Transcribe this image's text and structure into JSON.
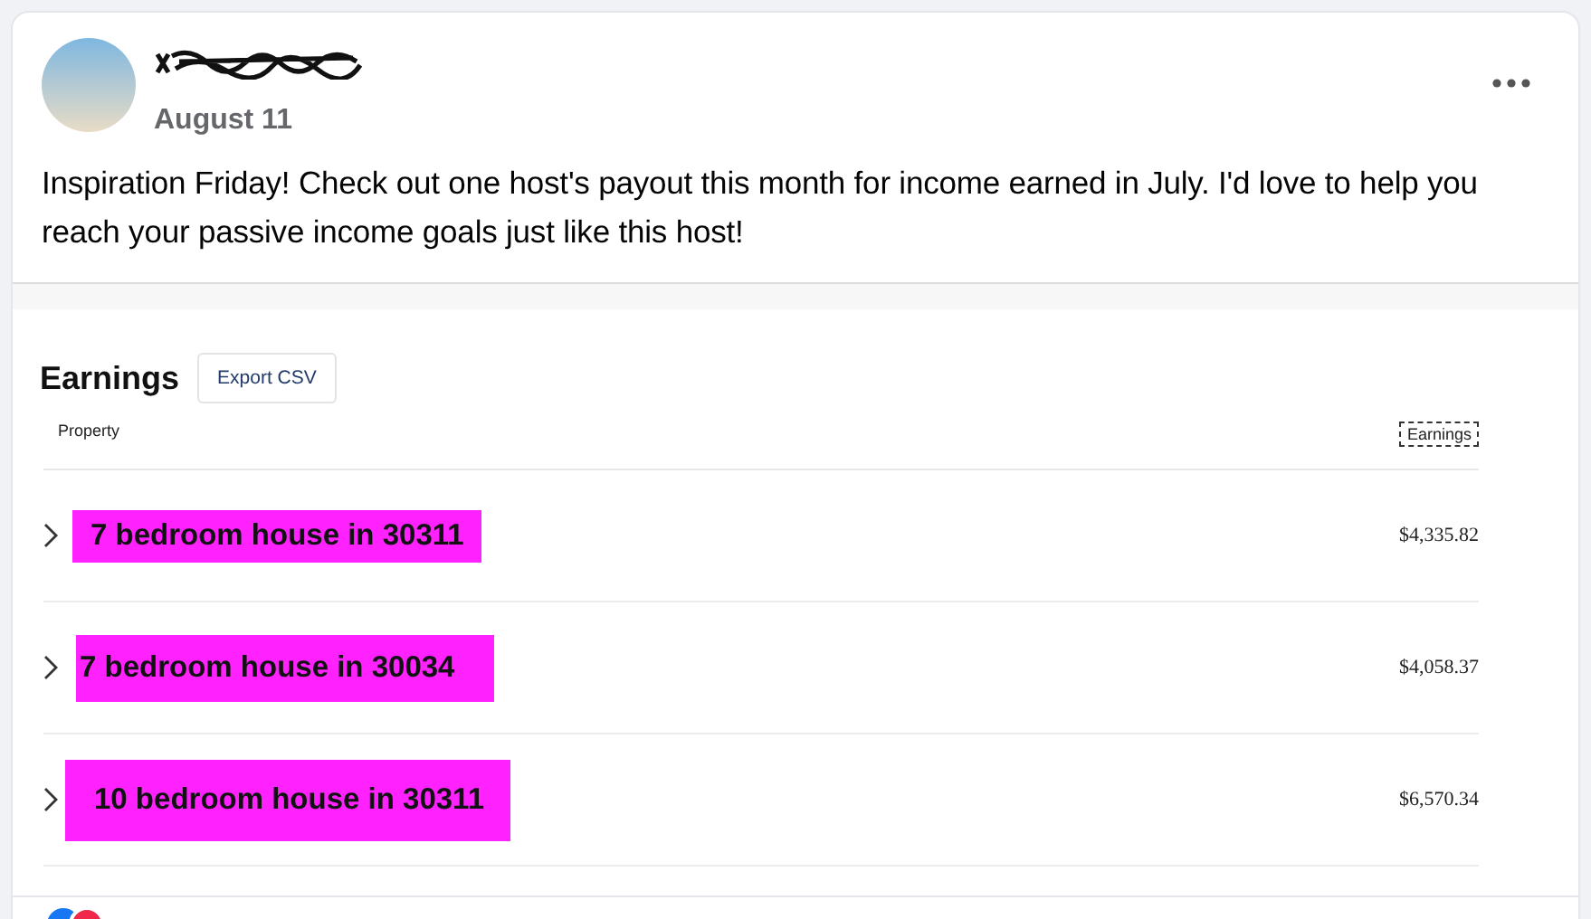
{
  "post": {
    "date": "August 11",
    "text": "Inspiration Friday! Check out one host's payout this month for income earned in July. I'd love to help you reach your passive income goals just like this host!"
  },
  "earnings": {
    "title": "Earnings",
    "export_button": "Export CSV",
    "columns": [
      "Property",
      "Earnings"
    ],
    "rows": [
      {
        "property": "7 bedroom house in 30311",
        "amount": "$4,335.82"
      },
      {
        "property": "7 bedroom house in 30034",
        "amount": "$4,058.37"
      },
      {
        "property": "10 bedroom house in 30311",
        "amount": "$6,570.34"
      }
    ]
  }
}
